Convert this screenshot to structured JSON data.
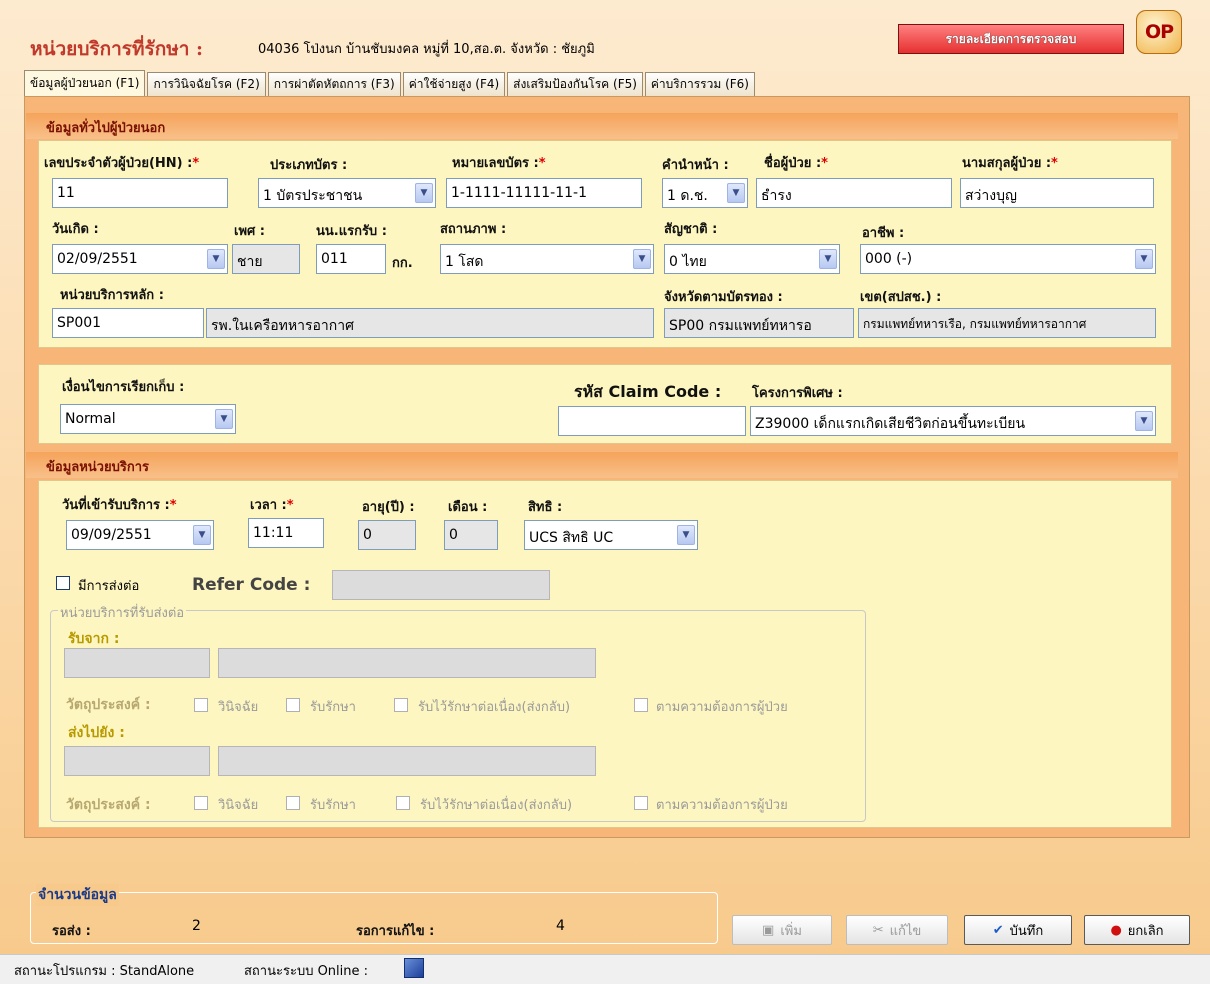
{
  "header": {
    "title": "หน่วยบริการที่รักษา :",
    "value": "04036 โป่งนก บ้านชับมงคล หมู่ที่ 10,สอ.ต. จังหวัด : ชัยภูมิ",
    "detail_button": "รายละเอียดการตรวจสอบ",
    "logo_text": "OP"
  },
  "tabs": [
    {
      "label": "ข้อมูลผู้ป่วยนอก (F1)"
    },
    {
      "label": "การวินิจฉัยโรค (F2)"
    },
    {
      "label": "การผ่าตัดหัตถการ (F3)"
    },
    {
      "label": "ค่าใช้จ่ายสูง (F4)"
    },
    {
      "label": "ส่งเสริมป้องกันโรค (F5)"
    },
    {
      "label": "ค่าบริการรวม (F6)"
    }
  ],
  "general": {
    "section_title": "ข้อมูลทั่วไปผู้ป่วยนอก",
    "hn_label": "เลขประจำตัวผู้ป่วย(HN) :",
    "hn_value": "11",
    "cardtype_label": "ประเภทบัตร :",
    "cardtype_value": "1 บัตรประชาชน",
    "cardno_label": "หมายเลขบัตร :",
    "cardno_value": "1-1111-11111-11-1",
    "prefix_label": "คำนำหน้า :",
    "prefix_value": "1 ด.ช.",
    "fname_label": "ชื่อผู้ป่วย :",
    "fname_value": "ธำรง",
    "lname_label": "นามสกุลผู้ป่วย :",
    "lname_value": "สว่างบุญ",
    "dob_label": "วันเกิด :",
    "dob_value": "02/09/2551",
    "sex_label": "เพศ :",
    "sex_value": "ชาย",
    "weight_label": "นน.แรกรับ :",
    "weight_value": "011",
    "weight_unit": "กก.",
    "marital_label": "สถานภาพ :",
    "marital_value": "1 โสด",
    "nation_label": "สัญชาติ :",
    "nation_value": "0 ไทย",
    "occupation_label": "อาชีพ :",
    "occupation_value": "000 (-)",
    "mainunit_label": "หน่วยบริการหลัก :",
    "mainunit_code": "SP001",
    "mainunit_name": "รพ.ในเครือทหารอากาศ",
    "province_label": "จังหวัดตามบัตรทอง :",
    "province_value": "SP00 กรมแพทย์ทหารอ",
    "zone_label": "เขต(สปสช.) :",
    "zone_value": "กรมแพทย์ทหารเรือ, กรมแพทย์ทหารอากาศ"
  },
  "claim": {
    "condition_label": "เงื่อนไขการเรียกเก็บ :",
    "condition_value": "Normal",
    "code_label": "รหัส Claim Code :",
    "code_value": "",
    "project_label": "โครงการพิเศษ :",
    "project_value": "Z39000 เด็กแรกเกิดเสียชีวิตก่อนขึ้นทะเบียน"
  },
  "service": {
    "section_title": "ข้อมูลหน่วยบริการ",
    "date_label": "วันที่เข้ารับบริการ :",
    "date_value": "09/09/2551",
    "time_label": "เวลา :",
    "time_value": "11:11",
    "age_label": "อายุ(ปี) :",
    "age_value": "0",
    "month_label": "เดือน :",
    "month_value": "0",
    "right_label": "สิทธิ :",
    "right_value": "UCS สิทธิ UC",
    "refer_check_label": "มีการส่งต่อ",
    "refer_code_label": "Refer Code :",
    "refer_group_label": "หน่วยบริการที่รับส่งต่อ",
    "from_label": "รับจาก :",
    "to_label": "ส่งไปยัง :",
    "purpose_label": "วัตถุประสงค์ :",
    "purposes": [
      "วินิจฉัย",
      "รับรักษา",
      "รับไว้รักษาต่อเนื่อง(ส่งกลับ)",
      "ตามความต้องการผู้ป่วย"
    ]
  },
  "summary": {
    "title": "จำนวนข้อมูล",
    "pending_label": "รอส่ง :",
    "pending_value": "2",
    "fix_label": "รอการแก้ไข :",
    "fix_value": "4"
  },
  "buttons": {
    "add": "เพิ่ม",
    "edit": "แก้ไข",
    "save": "บันทึก",
    "cancel": "ยกเลิก"
  },
  "status": {
    "program": "สถานะโปรแกรม : StandAlone",
    "system": "สถานะระบบ Online :"
  }
}
